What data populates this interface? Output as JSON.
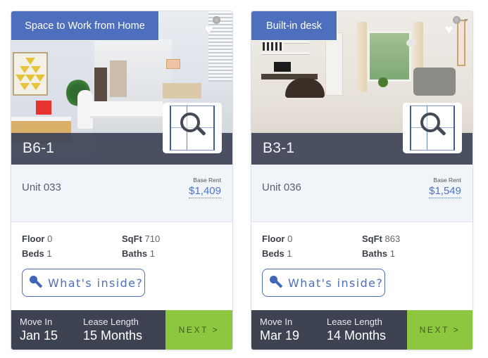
{
  "cards": [
    {
      "tag": "Space to Work from Home",
      "unit_code": "B6-1",
      "unit_label": "Unit 033",
      "base_rent_label": "Base Rent",
      "base_rent": "$1,409",
      "specs": {
        "floor_label": "Floor",
        "floor": "0",
        "sqft_label": "SqFt",
        "sqft": "710",
        "beds_label": "Beds",
        "beds": "1",
        "baths_label": "Baths",
        "baths": "1"
      },
      "inside_button": "What's inside?",
      "move_in_label": "Move In",
      "move_in": "Jan 15",
      "lease_label": "Lease Length",
      "lease": "15 Months",
      "next_button": "NEXT >"
    },
    {
      "tag": "Built-in desk",
      "unit_code": "B3-1",
      "unit_label": "Unit 036",
      "base_rent_label": "Base Rent",
      "base_rent": "$1,549",
      "specs": {
        "floor_label": "Floor",
        "floor": "0",
        "sqft_label": "SqFt",
        "sqft": "863",
        "beds_label": "Beds",
        "beds": "1",
        "baths_label": "Baths",
        "baths": "1"
      },
      "inside_button": "What's inside?",
      "move_in_label": "Move In",
      "move_in": "Mar 19",
      "lease_label": "Lease Length",
      "lease": "14 Months",
      "next_button": "NEXT >"
    }
  ],
  "icons": {
    "favorite": "heart-icon",
    "settings": "gear-icon",
    "floorplan_zoom": "magnifier-icon",
    "inside": "key-icon"
  },
  "colors": {
    "tag_bg": "#4e6fbd",
    "band_bg": "#3e4352",
    "next_bg": "#8dc63f",
    "rent_link": "#4e74c4",
    "rent_row_bg": "#f1f4f9"
  },
  "glyphs": {
    "heart": "♥"
  }
}
